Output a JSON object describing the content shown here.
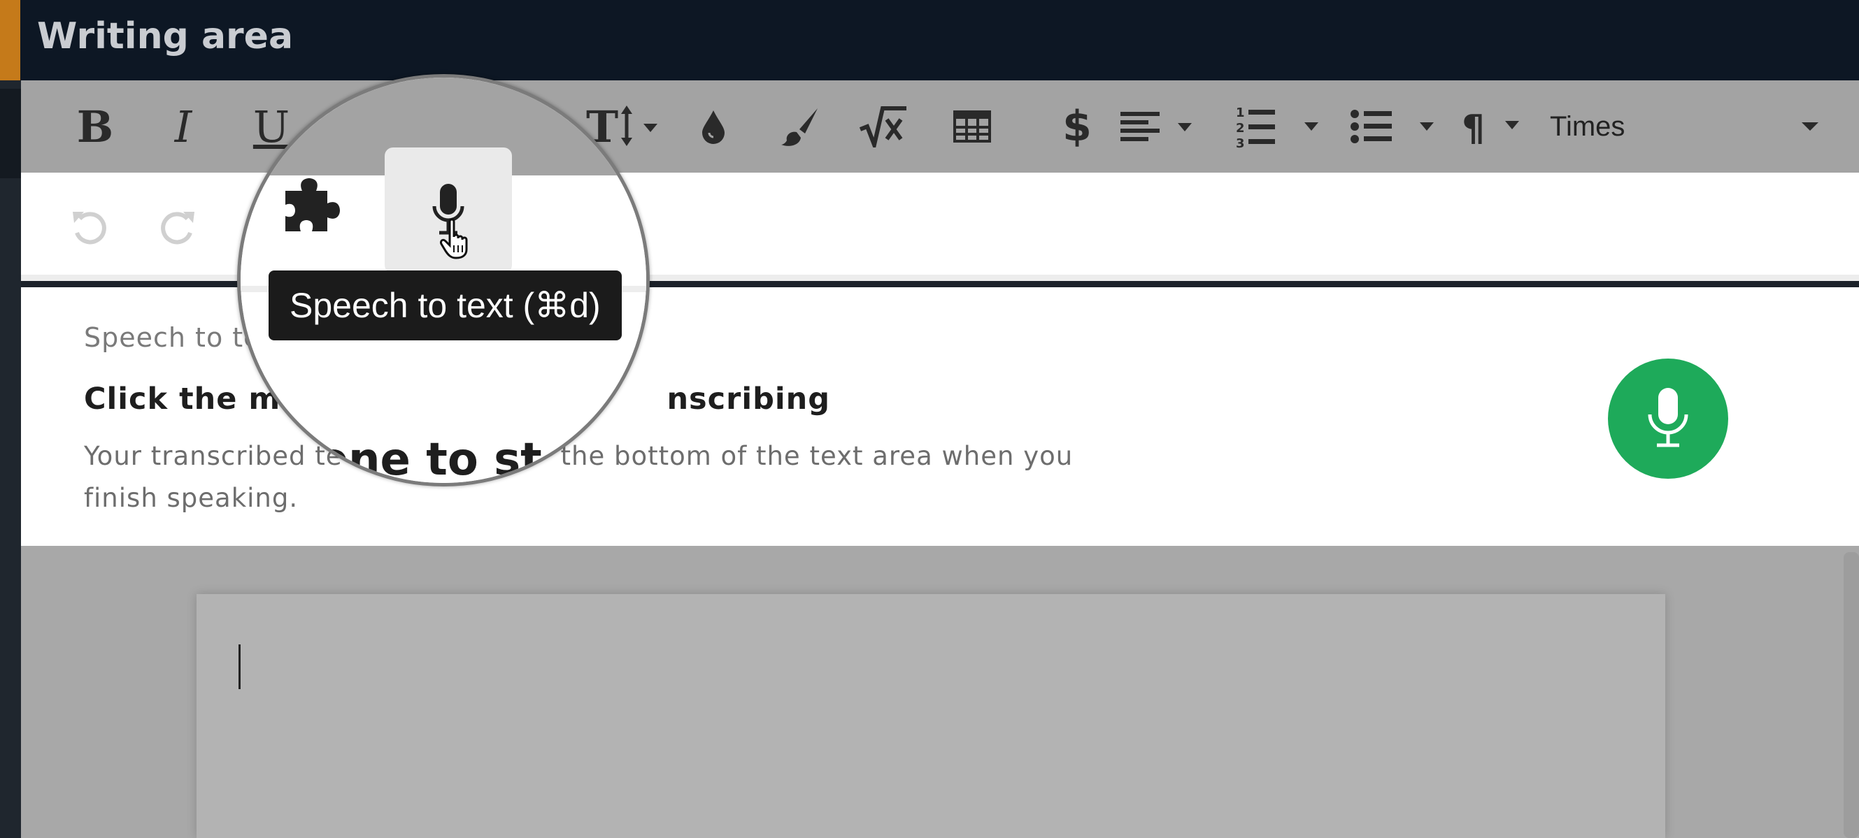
{
  "app": {
    "title": "Writing area"
  },
  "toolbar": {
    "font_name": "Times",
    "icons": [
      "bold-icon",
      "italic-icon",
      "underline-icon",
      "text-size-icon",
      "text-color-icon",
      "highlight-brush-icon",
      "math-icon",
      "table-icon",
      "dollar-icon",
      "align-left-icon",
      "numbered-list-icon",
      "bulleted-list-icon",
      "paragraph-icon"
    ]
  },
  "row2": {
    "icons": [
      "undo-icon",
      "redo-icon",
      "puzzle-icon",
      "microphone-icon"
    ]
  },
  "speech": {
    "label_visible": "Speech to te",
    "heading_visible": "Click the mic",
    "heading_tail": "nscribing",
    "desc_line1_start": "Your transcribed te",
    "desc_line1_end": "the bottom of the text area when you",
    "desc_line2": "finish speaking."
  },
  "magnifier": {
    "tooltip": "Speech to text (⌘d)",
    "zoomed_text": "one to st"
  },
  "colors": {
    "accent": "#c57a1a",
    "topbar": "#0d1724",
    "mic_button": "#1eaa5a",
    "toolbar": "#a3a3a3"
  }
}
